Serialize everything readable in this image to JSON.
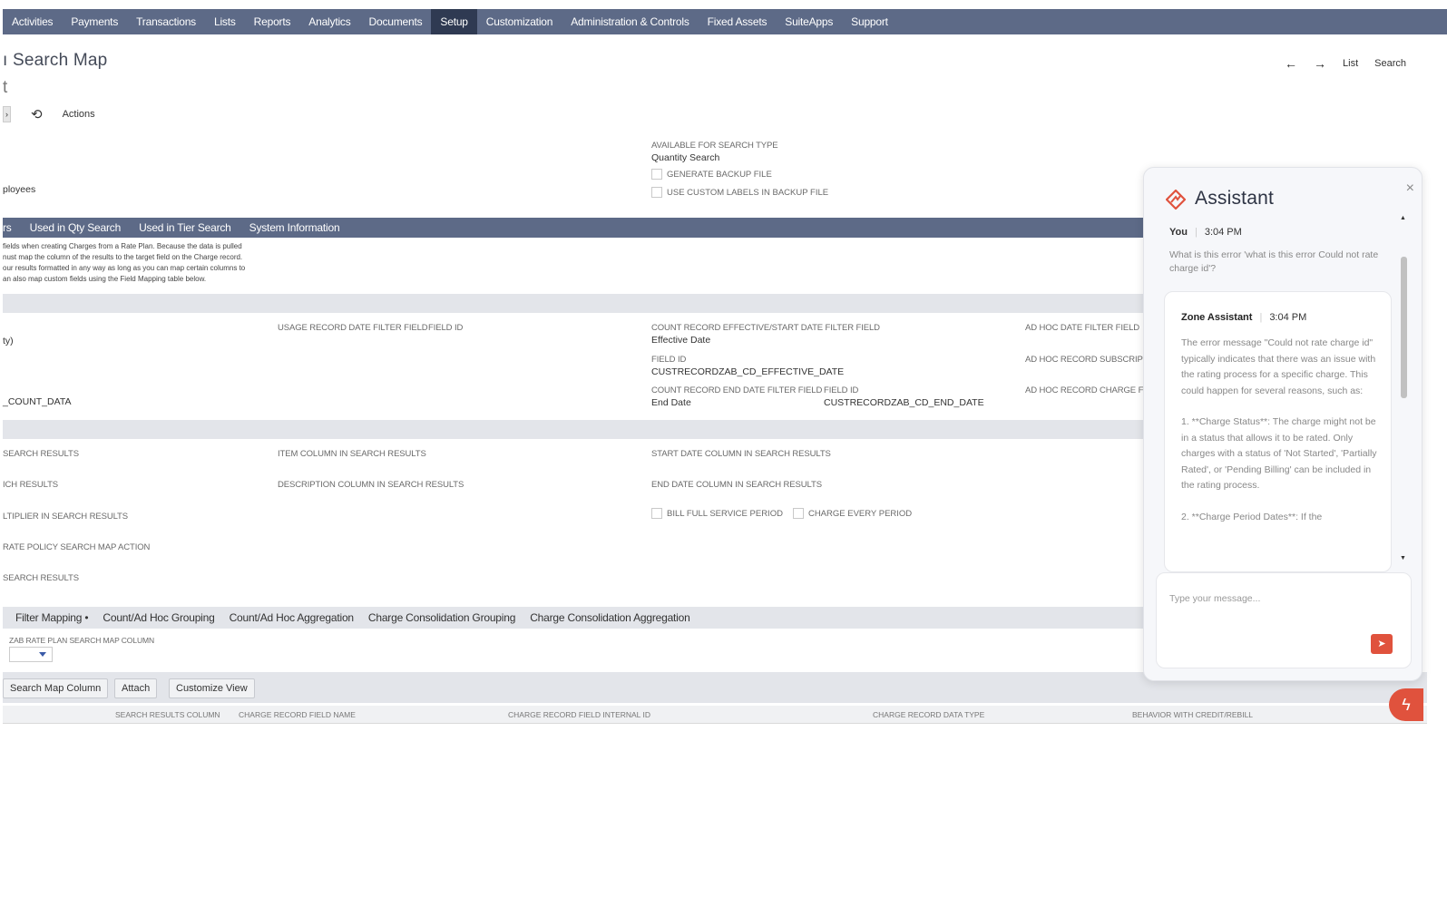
{
  "nav": {
    "items": [
      "Activities",
      "Payments",
      "Transactions",
      "Lists",
      "Reports",
      "Analytics",
      "Documents",
      "Setup",
      "Customization",
      "Administration & Controls",
      "Fixed Assets",
      "SuiteApps",
      "Support"
    ],
    "active": "Setup"
  },
  "header": {
    "title": "ı Search Map",
    "subtitle": "t",
    "back_arrow": "←",
    "forward_arrow": "→",
    "list_link": "List",
    "search_link": "Search",
    "actions_label": "Actions"
  },
  "primary": {
    "employees_text": "ployees",
    "available_label": "AVAILABLE FOR SEARCH TYPE",
    "available_value": "Quantity Search",
    "generate_backup_label": "GENERATE BACKUP FILE",
    "custom_labels_label": "USE CUSTOM LABELS IN BACKUP FILE"
  },
  "subtabs": [
    "rs",
    "Used in Qty Search",
    "Used in Tier Search",
    "System Information"
  ],
  "help_text": [
    "fields when creating Charges from a Rate Plan. Because the data is pulled",
    "nust map the column of the results to the target field on the Charge record.",
    "our results formatted in any way as long as you can map certain columns to",
    "an also map custom fields using the Field Mapping table below."
  ],
  "filters": {
    "left_value_1": "ty)",
    "left_value_2": "_COUNT_DATA",
    "usage_date_label": "USAGE RECORD DATE FILTER FIELD",
    "usage_field_id_label": "FIELD ID",
    "count_start_label": "COUNT RECORD EFFECTIVE/START DATE FILTER FIELD",
    "count_start_value": "Effective Date",
    "field_id_label": "FIELD ID",
    "field_id_value": "CUSTRECORDZAB_CD_EFFECTIVE_DATE",
    "count_end_label": "COUNT RECORD END DATE FILTER FIELD",
    "count_end_value": "End Date",
    "end_field_id_label": "FIELD ID",
    "end_field_id_value": "CUSTRECORDZAB_CD_END_DATE",
    "adhoc_date_label": "AD HOC DATE FILTER FIELD",
    "adhoc_subscr_label": "AD HOC RECORD SUBSCRIPT",
    "adhoc_charge_label": "AD HOC RECORD CHARGE FI"
  },
  "columns": {
    "col1_row1": "SEARCH RESULTS",
    "col1_row2": "ICH RESULTS",
    "col1_row3": "LTIPLIER IN SEARCH RESULTS",
    "col1_row4": "RATE POLICY SEARCH MAP",
    "col1_row4b": "ACTION",
    "col1_row5": "SEARCH RESULTS",
    "item_column": "ITEM COLUMN IN SEARCH RESULTS",
    "description_column": "DESCRIPTION COLUMN IN SEARCH RESULTS",
    "start_date_column": "START DATE COLUMN IN SEARCH RESULTS",
    "end_date_column": "END DATE COLUMN IN SEARCH RESULTS",
    "bill_full_label": "BILL FULL SERVICE PERIOD",
    "charge_every_label": "CHARGE EVERY PERIOD"
  },
  "mapping_tabs": [
    "Filter Mapping •",
    "Count/Ad Hoc Grouping",
    "Count/Ad Hoc Aggregation",
    "Charge Consolidation Grouping",
    "Charge Consolidation Aggregation"
  ],
  "zab_label": "ZAB RATE PLAN SEARCH MAP COLUMN",
  "buttons": {
    "search_map_column": "Search Map Column",
    "attach": "Attach",
    "customize_view": "Customize View"
  },
  "table_headers": [
    "SEARCH RESULTS COLUMN",
    "CHARGE RECORD FIELD NAME",
    "CHARGE RECORD FIELD INTERNAL ID",
    "CHARGE RECORD DATA TYPE",
    "BEHAVIOR WITH CREDIT/REBILL"
  ],
  "assistant": {
    "title": "Assistant",
    "you_label": "You",
    "you_time": "3:04 PM",
    "user_message": "What is this error 'what is this error Could not rate charge id'?",
    "bot_name": "Zone Assistant",
    "bot_time": "3:04 PM",
    "bot_paragraphs": [
      "The error message \"Could not rate charge id\" typically indicates that there was an issue with the rating process for a specific charge. This could happen for several reasons, such as:",
      "1. **Charge Status**: The charge might not be in a status that allows it to be rated. Only charges with a status of 'Not Started', 'Partially Rated', or 'Pending Billing' can be included in the rating process.",
      "2. **Charge Period Dates**: If the"
    ],
    "input_placeholder": "Type your message...",
    "close_glyph": "×",
    "send_glyph": "➤"
  },
  "colors": {
    "nav_bg": "#5d6a87",
    "nav_active": "#2f3a52",
    "accent": "#e0523d"
  }
}
